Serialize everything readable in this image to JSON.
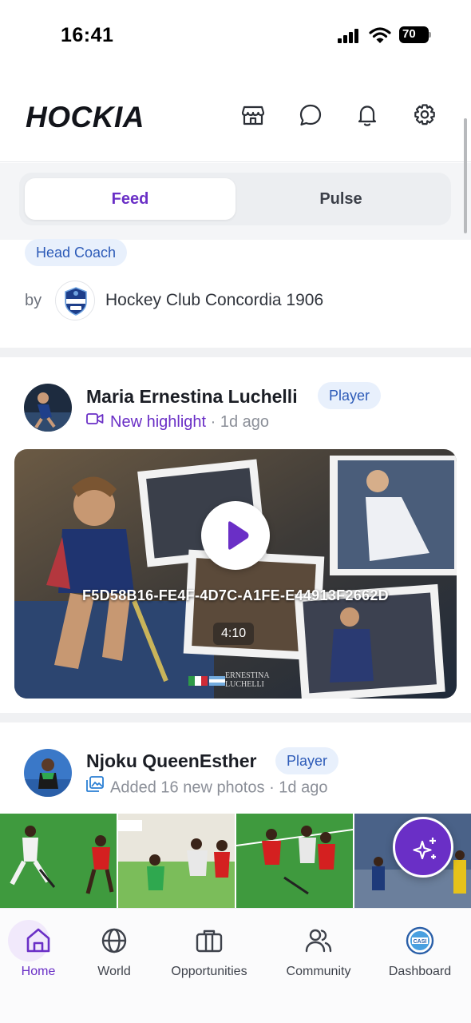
{
  "status_bar": {
    "time": "16:41",
    "battery": "70"
  },
  "header": {
    "logo": "HOCKIA",
    "icons": [
      "store-icon",
      "chat-icon",
      "bell-icon",
      "gear-icon"
    ]
  },
  "tabs": [
    {
      "label": "Feed",
      "active": true
    },
    {
      "label": "Pulse",
      "active": false
    }
  ],
  "opportunity": {
    "role": "Head Coach",
    "by_label": "by",
    "club_name": "Hockey Club Concordia 1906"
  },
  "posts": [
    {
      "author": "Maria Ernestina Luchelli",
      "role": "Player",
      "action": "New highlight",
      "time": "· 1d ago",
      "video": {
        "id": "F5D58B16-FE4F-4D7C-A1FE-E44913F2662D",
        "duration": "4:10",
        "watermark_line1": "ERNESTINA",
        "watermark_line2": "LUCHELLI"
      }
    },
    {
      "author": "Njoku QueenEsther",
      "role": "Player",
      "action": "Added 16 new photos",
      "time": "· 1d ago"
    }
  ],
  "bottom_nav": [
    {
      "label": "Home",
      "icon": "home-icon",
      "active": true
    },
    {
      "label": "World",
      "icon": "globe-icon",
      "active": false
    },
    {
      "label": "Opportunities",
      "icon": "briefcase-icon",
      "active": false
    },
    {
      "label": "Community",
      "icon": "users-icon",
      "active": false
    },
    {
      "label": "Dashboard",
      "icon": "club-badge-icon",
      "active": false
    }
  ],
  "colors": {
    "accent": "#6a2fc6",
    "chip_bg": "#e8f0fc",
    "chip_text": "#2d5bb8"
  }
}
